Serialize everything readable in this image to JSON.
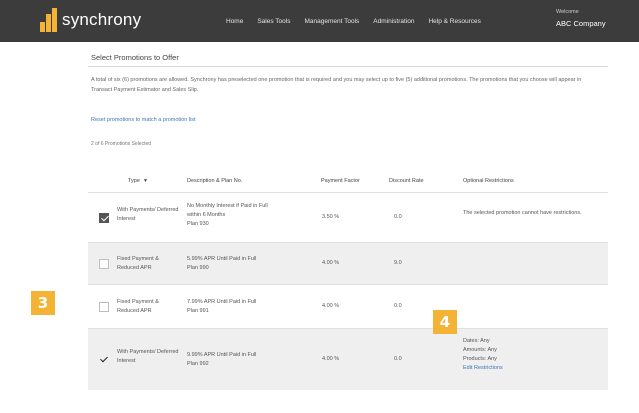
{
  "header": {
    "brand": "synchrony",
    "nav": [
      "Home",
      "Sales Tools",
      "Management Tools",
      "Administration",
      "Help & Resources"
    ],
    "welcome_label": "Welcome",
    "company": "ABC Company"
  },
  "page": {
    "title": "Select Promotions to Offer",
    "intro": "A total of six (6) promotions are allowed. Synchrony has preselected one promotion that is required and you may select up to five (5) additional promotions. The promotions that you choose will appear in Transact Payment Estimator and Sales Slip.",
    "reset_link": "Reset promotions to match a promotion list",
    "selected_count": "2 of 6 Promotions Selected"
  },
  "table": {
    "headers": {
      "type": "Type",
      "description": "Description & Plan No.",
      "payment_factor": "Payment Factor",
      "discount_rate": "Discount Rate",
      "optional_restrictions": "Optional Restrictions"
    },
    "rows": [
      {
        "checked": true,
        "type": "With Payments/ Deferred Interest",
        "description": "No Monthly Interest if Paid in Full within 6 Months",
        "plan": "Plan 930",
        "payment_factor": "3.50 %",
        "discount_rate": "0.0",
        "restrictions": "The selected promotion cannot have restrictions.",
        "restriction_link": ""
      },
      {
        "checked": false,
        "type": "Fixed Payment & Reduced APR",
        "description": "5.99% APR Until Paid in Full",
        "plan": "Plan 990",
        "payment_factor": "4.00 %",
        "discount_rate": "9.0",
        "restrictions": "",
        "restriction_link": ""
      },
      {
        "checked": false,
        "type": "Fixed Payment & Reduced APR",
        "description": "7.99% APR Until Paid in Full",
        "plan": "Plan 991",
        "payment_factor": "4.00 %",
        "discount_rate": "0.0",
        "restrictions": "",
        "restriction_link": ""
      },
      {
        "checked": true,
        "type": "With Payments/ Deferred Interest",
        "description": "9.99% APR Until Paid in Full",
        "plan": "Plan 992",
        "payment_factor": "4.00 %",
        "discount_rate": "0.0",
        "restrictions": "Dates: Any\nAmounts: Any\nProducts: Any",
        "restriction_link": "Edit Restrictions"
      }
    ]
  },
  "markers": [
    "3",
    "4"
  ],
  "colors": {
    "header_bg": "#3c3c3c",
    "accent": "#f5b335",
    "link": "#3a77b7",
    "row_shade": "#efefef"
  }
}
